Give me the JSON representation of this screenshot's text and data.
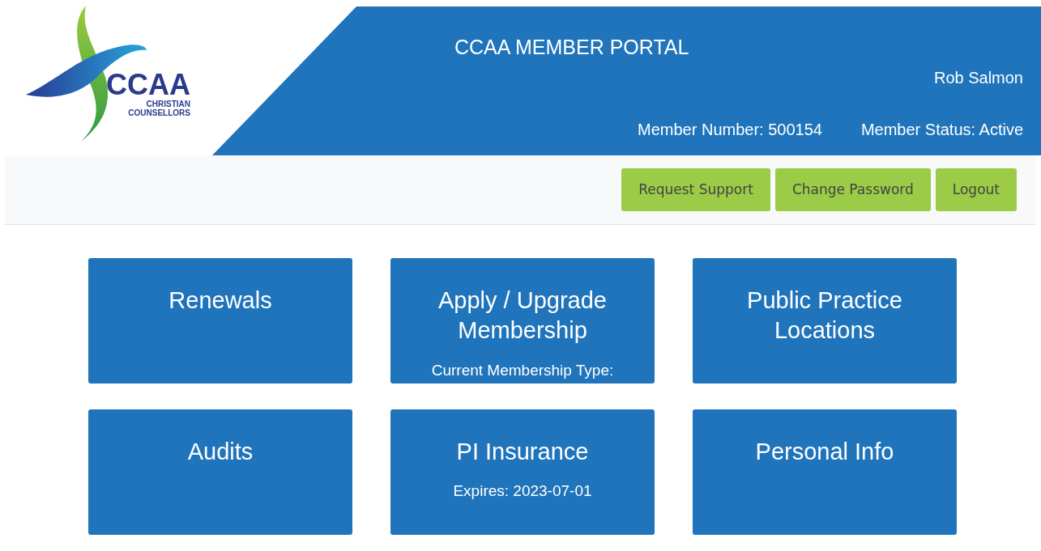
{
  "logo": {
    "name": "CCAA",
    "line_1": "CHRISTIAN",
    "line_2": "COUNSELLORS"
  },
  "header": {
    "title": "CCAA MEMBER PORTAL",
    "user_name": "Rob Salmon",
    "member_number": "Member Number: 500154",
    "member_status": "Member Status: Active"
  },
  "toolbar": {
    "buttons": [
      "Request Support",
      "Change Password",
      "Logout"
    ]
  },
  "tiles": [
    {
      "title": "Renewals"
    },
    {
      "title": "Apply / Upgrade Membership",
      "subtitle": "Current Membership Type:"
    },
    {
      "title": "Public Practice Locations"
    },
    {
      "title": "Audits"
    },
    {
      "title": "PI Insurance",
      "subtitle": "Expires: 2023-07-01"
    },
    {
      "title": "Personal Info"
    }
  ]
}
